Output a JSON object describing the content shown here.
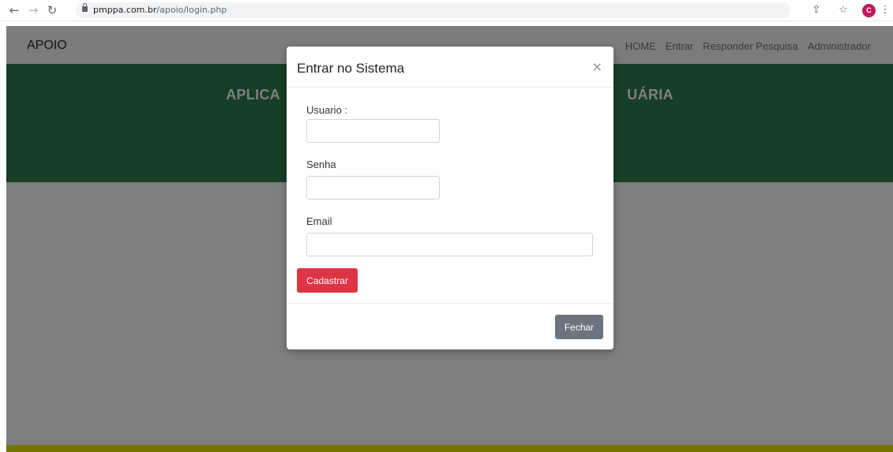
{
  "browser": {
    "url_host": "pmppa.com.br",
    "url_path": "/apoio/login.php",
    "profile_initial": "C"
  },
  "navbar": {
    "brand": "APOIO",
    "links": [
      "HOME",
      "Entrar",
      "Responder Pesquisa",
      "Administrador"
    ]
  },
  "hero": {
    "title": "APLICA                                                                                   UÁRIA"
  },
  "modal": {
    "title": "Entrar no Sistema",
    "close": "×",
    "usuario_label": "Usuario :",
    "usuario_value": "",
    "senha_label": "Senha",
    "senha_value": "",
    "email_label": "Email",
    "email_value": "",
    "cadastrar_label": "Cadastrar",
    "fechar_label": "Fechar"
  },
  "colors": {
    "hero": "#2e7d4f",
    "danger": "#dc3545",
    "secondary": "#6c757d",
    "footer_strip": "#e6e600"
  }
}
